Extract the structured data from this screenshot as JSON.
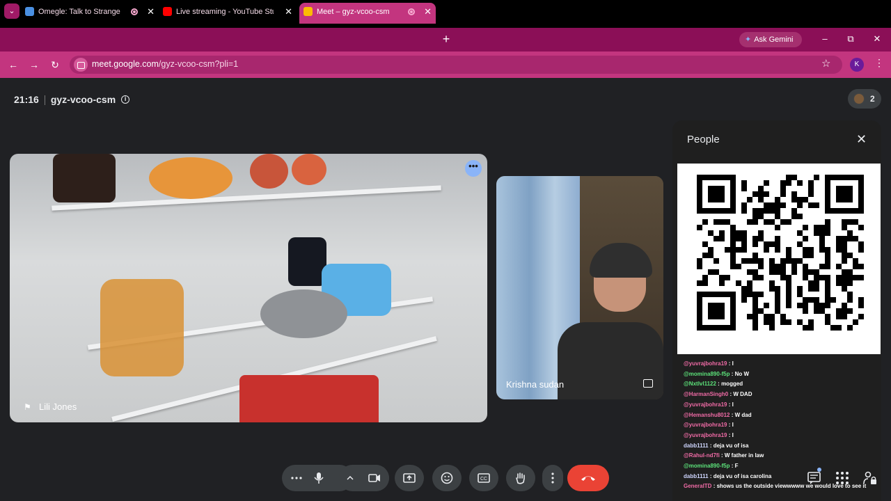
{
  "browser": {
    "tabs": [
      {
        "title": "Omegle: Talk to Strangers! |",
        "favicon_color": "#4a90e2",
        "recording": true,
        "active": false
      },
      {
        "title": "Live streaming - YouTube Studio",
        "favicon_color": "#ff0000",
        "recording": false,
        "active": false
      },
      {
        "title": "Meet – gyz-vcoo-csm",
        "favicon_color": "#fbbc04",
        "recording": true,
        "active": true
      }
    ],
    "gemini_label": "Ask Gemini",
    "url_host": "meet.google.com",
    "url_path": "/gyz-vcoo-csm?pli=1",
    "profile_initial": "K",
    "colors": {
      "frame": "#8b0f57",
      "toolbar": "#c3357f"
    }
  },
  "meeting": {
    "time": "21:16",
    "code": "gyz-vcoo-csm",
    "participant_count": "2"
  },
  "tiles": {
    "main_name": "Lili Jones",
    "side_name": "Krishna sudan"
  },
  "panel": {
    "title": "People",
    "chat": [
      {
        "user": "@yuvrajbohra19",
        "msg": "I",
        "color": "#f06ba6"
      },
      {
        "user": "@momina890-f5p",
        "msg": "No W",
        "color": "#5ce27a"
      },
      {
        "user": "@Nxtlvl1122",
        "msg": "mogged",
        "color": "#5ce27a"
      },
      {
        "user": "@HarmanSingh0",
        "msg": "W DAD",
        "color": "#f06ba6"
      },
      {
        "user": "@yuvrajbohra19",
        "msg": "I",
        "color": "#f06ba6"
      },
      {
        "user": "@Hemanshu8012",
        "msg": "W dad",
        "color": "#f06ba6"
      },
      {
        "user": "@yuvrajbohra19",
        "msg": "I",
        "color": "#f06ba6"
      },
      {
        "user": "@yuvrajbohra19",
        "msg": "I",
        "color": "#f06ba6"
      },
      {
        "user": "dabb1111",
        "msg": "deja vu of isa",
        "color": "#cfd6ff"
      },
      {
        "user": "@Rahul-nd7fi",
        "msg": "W father in law",
        "color": "#f06ba6"
      },
      {
        "user": "@momina890-f5p",
        "msg": "F",
        "color": "#5ce27a"
      },
      {
        "user": "dabb1111",
        "msg": "deja vu of isa carolina",
        "color": "#cfd6ff"
      },
      {
        "user": "GeneralTD",
        "msg": "shows us the outside viewwwww we would love to see it",
        "color": "#f06ba6"
      }
    ]
  },
  "controls": {
    "icons": [
      "more-options-icon",
      "microphone-icon",
      "chevron-up-icon",
      "camera-icon",
      "present-icon",
      "emoji-icon",
      "captions-icon",
      "raise-hand-icon",
      "more-vert-icon",
      "end-call-icon"
    ],
    "end_color": "#ea4335"
  }
}
